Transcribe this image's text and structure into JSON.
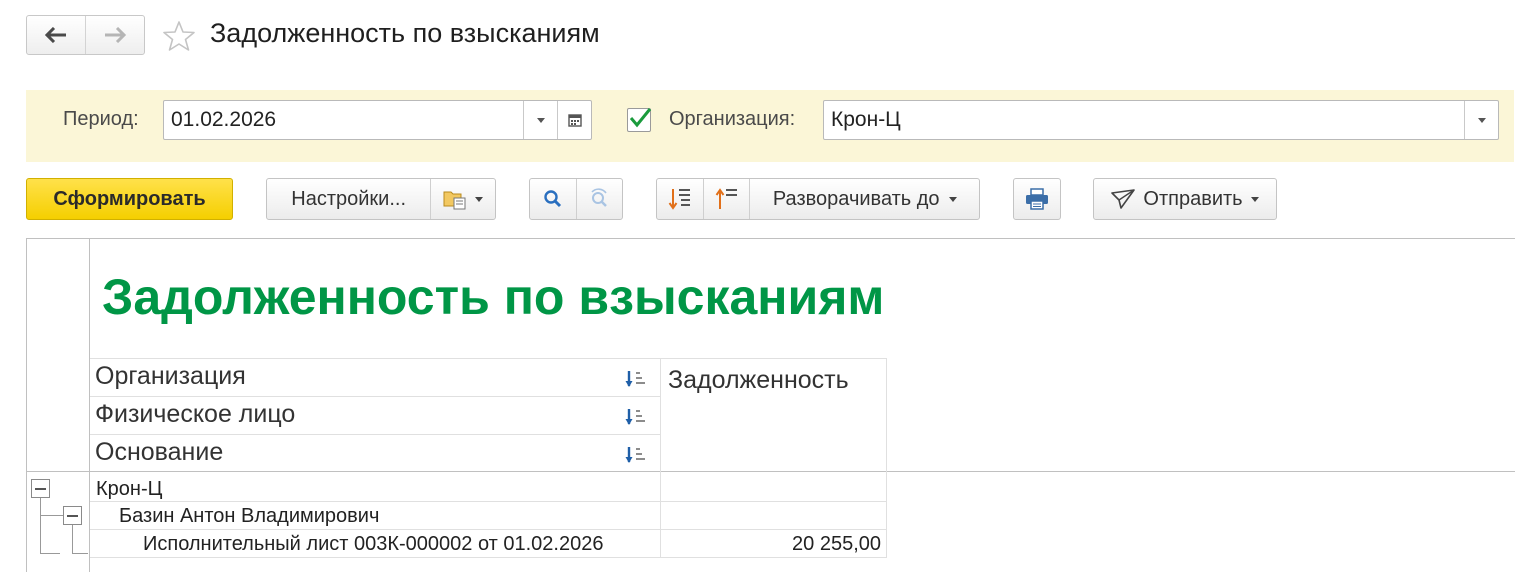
{
  "window": {
    "title": "Задолженность по взысканиям"
  },
  "filters": {
    "period_label": "Период:",
    "period_value": "01.02.2026",
    "org_checked": true,
    "org_label": "Организация:",
    "org_value": "Крон-Ц"
  },
  "toolbar": {
    "generate_label": "Сформировать",
    "settings_label": "Настройки...",
    "expand_label": "Разворачивать до",
    "send_label": "Отправить"
  },
  "report": {
    "title": "Задолженность по взысканиям",
    "headers": {
      "organization": "Организация",
      "person": "Физическое лицо",
      "basis": "Основание",
      "debt": "Задолженность"
    },
    "rows": [
      {
        "label": "Крон-Ц",
        "debt": ""
      },
      {
        "label": "Базин Антон Владимирович",
        "debt": ""
      },
      {
        "label": "Исполнительный лист 003К-000002 от 01.02.2026",
        "debt": "20 255,00"
      }
    ]
  },
  "colors": {
    "report_title": "#009646",
    "primary_button": "#f5cf00",
    "filter_panel": "#fbf6d7",
    "checkmark": "#1a9b3c"
  }
}
